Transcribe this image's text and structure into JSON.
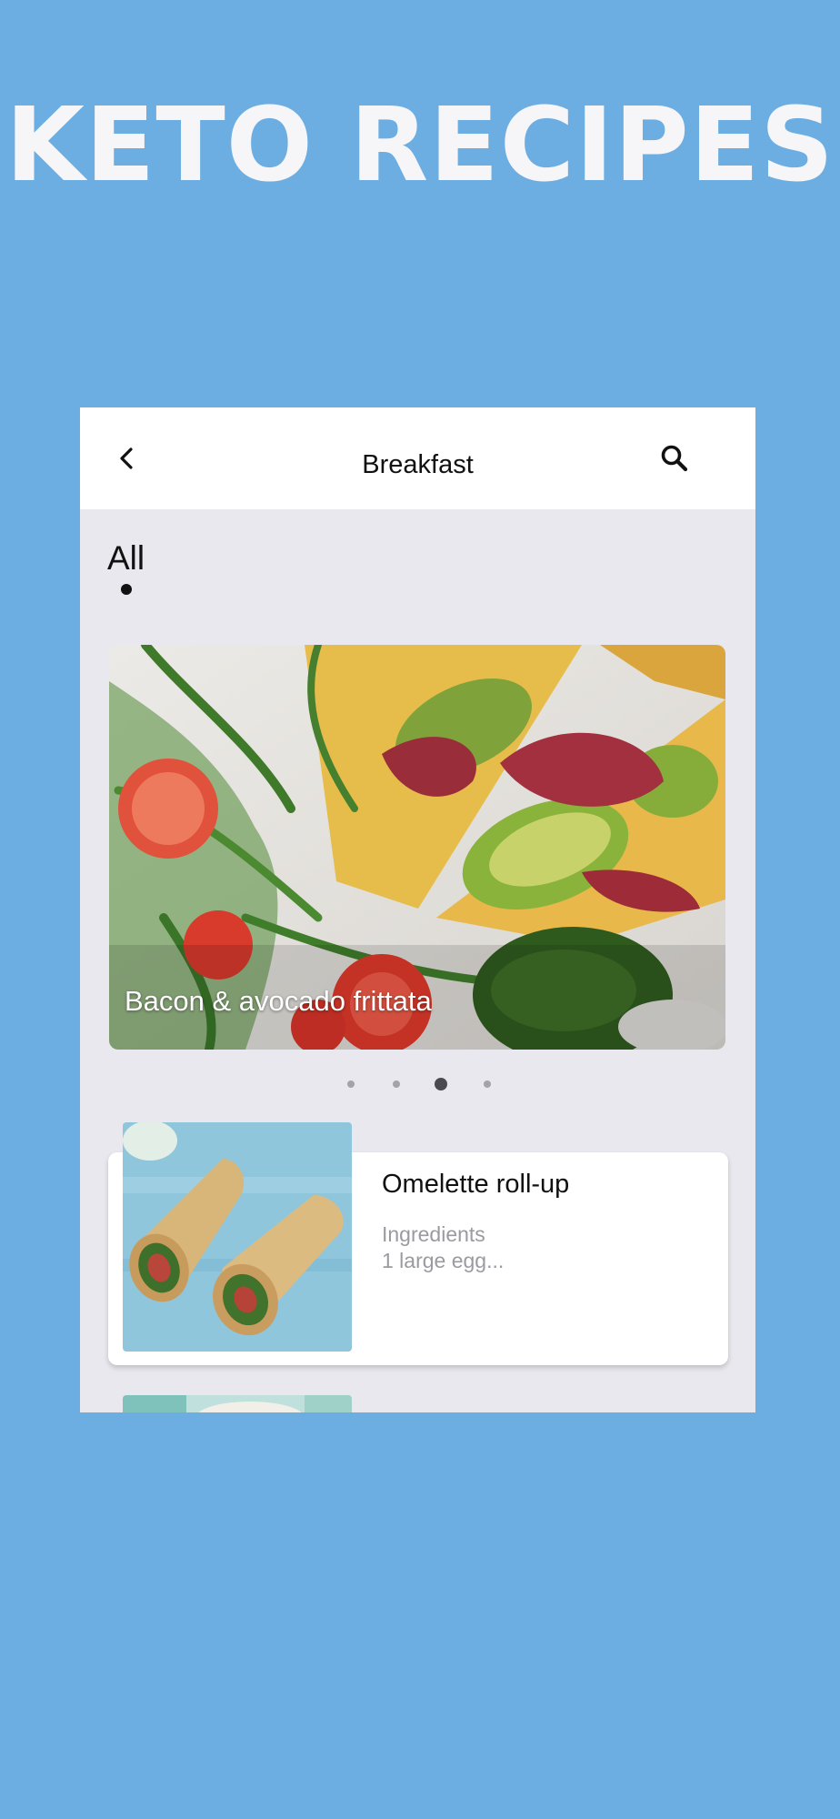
{
  "promo": {
    "title": "KETO RECIPES"
  },
  "appbar": {
    "title": "Breakfast",
    "back_icon": "chevron-left-icon",
    "search_icon": "search-icon"
  },
  "tabs": [
    {
      "label": "All",
      "selected": true
    }
  ],
  "featured": {
    "caption": "Bacon & avocado frittata",
    "pager_count": 4,
    "pager_active_index": 2
  },
  "recipes": [
    {
      "title": "Omelette roll-up",
      "ingredients_label": "Ingredients",
      "ingredients_preview": "1 large egg..."
    }
  ],
  "colors": {
    "background": "#6daee2",
    "promo_text": "#f6f6f8",
    "app_surface": "#e9e8ee",
    "card": "#ffffff",
    "muted_text": "#9a9aa0"
  }
}
